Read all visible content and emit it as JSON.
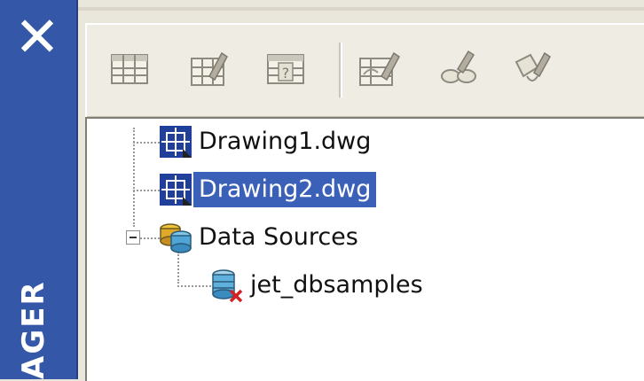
{
  "window": {
    "side_title": "AGER",
    "close_icon": "close-icon",
    "accent": "#3457a8"
  },
  "toolbar": {
    "buttons": [
      {
        "name": "table-icon"
      },
      {
        "name": "edit-table-icon"
      },
      {
        "name": "query-icon"
      },
      {
        "name": "link-template-icon"
      },
      {
        "name": "link-objects-icon"
      },
      {
        "name": "label-template-icon"
      }
    ]
  },
  "tree": {
    "items": [
      {
        "label": "Drawing1.dwg",
        "icon": "drawing-icon",
        "selected": false
      },
      {
        "label": "Drawing2.dwg",
        "icon": "drawing-icon",
        "selected": true
      },
      {
        "label": "Data Sources",
        "icon": "data-sources-icon",
        "expanded": true
      },
      {
        "label": "jet_dbsamples",
        "icon": "database-disconnected-icon"
      }
    ],
    "selection_color": "#3a60b8"
  }
}
